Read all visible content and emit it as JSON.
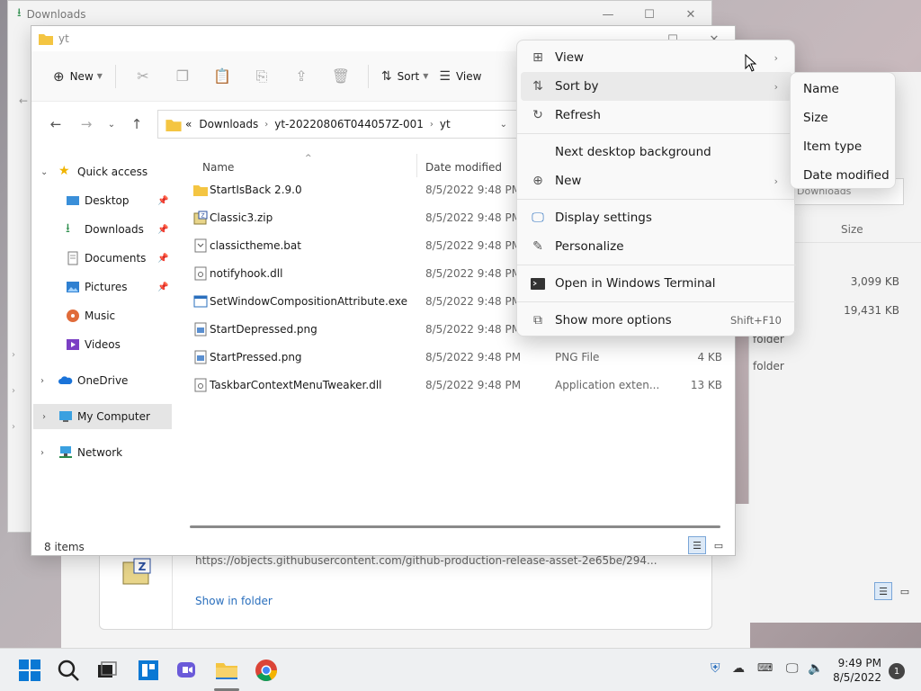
{
  "back_window": {
    "title": "Downloads"
  },
  "right_window": {
    "search_placeholder": "Downloads",
    "size_header": "Size",
    "sizes": [
      "3,099 KB",
      "19,431 KB"
    ],
    "folder_labels": [
      "folder",
      "folder"
    ]
  },
  "downloads_card": {
    "url": "https://objects.githubusercontent.com/github-production-release-asset-2e65be/294...",
    "show_in_folder": "Show in folder"
  },
  "main_window": {
    "title": "yt",
    "toolbar": {
      "new_label": "New",
      "sort_label": "Sort",
      "view_label": "View"
    },
    "address": {
      "overflow": "«",
      "crumbs": [
        "Downloads",
        "yt-20220806T044057Z-001",
        "yt"
      ]
    },
    "sidebar": {
      "quick_access": "Quick access",
      "items": [
        "Desktop",
        "Downloads",
        "Documents",
        "Pictures",
        "Music",
        "Videos"
      ],
      "onedrive": "OneDrive",
      "my_computer": "My Computer",
      "network": "Network"
    },
    "columns": {
      "name": "Name",
      "date": "Date modified"
    },
    "files": [
      {
        "name": "StartIsBack 2.9.0",
        "date": "8/5/2022 9:48 PM",
        "type": "",
        "size": "",
        "icon": "folder-icon"
      },
      {
        "name": "Classic3.zip",
        "date": "8/5/2022 9:48 PM",
        "type": "",
        "size": "",
        "icon": "zip-icon"
      },
      {
        "name": "classictheme.bat",
        "date": "8/5/2022 9:48 PM",
        "type": "",
        "size": "",
        "icon": "bat-icon"
      },
      {
        "name": "notifyhook.dll",
        "date": "8/5/2022 9:48 PM",
        "type": "",
        "size": "",
        "icon": "dll-icon"
      },
      {
        "name": "SetWindowCompositionAttribute.exe",
        "date": "8/5/2022 9:48 PM",
        "type": "",
        "size": "",
        "icon": "exe-icon"
      },
      {
        "name": "StartDepressed.png",
        "date": "8/5/2022 9:48 PM",
        "type": "",
        "size": "",
        "icon": "png-icon"
      },
      {
        "name": "StartPressed.png",
        "date": "8/5/2022 9:48 PM",
        "type": "PNG File",
        "size": "4 KB",
        "icon": "png-icon"
      },
      {
        "name": "TaskbarContextMenuTweaker.dll",
        "date": "8/5/2022 9:48 PM",
        "type": "Application exten...",
        "size": "13 KB",
        "icon": "dll-icon"
      }
    ],
    "status": "8 items"
  },
  "context_menu": {
    "items": {
      "view": "View",
      "sort_by": "Sort by",
      "refresh": "Refresh",
      "next_bg": "Next desktop background",
      "new": "New",
      "display": "Display settings",
      "personalize": "Personalize",
      "terminal": "Open in Windows Terminal",
      "more": "Show more options",
      "more_shortcut": "Shift+F10"
    },
    "submenu": [
      "Name",
      "Size",
      "Item type",
      "Date modified"
    ]
  },
  "taskbar": {
    "time": "9:49 PM",
    "date": "8/5/2022",
    "notifications": "1"
  },
  "colors": {
    "accent": "#0067c0",
    "folder": "#f4c542"
  }
}
